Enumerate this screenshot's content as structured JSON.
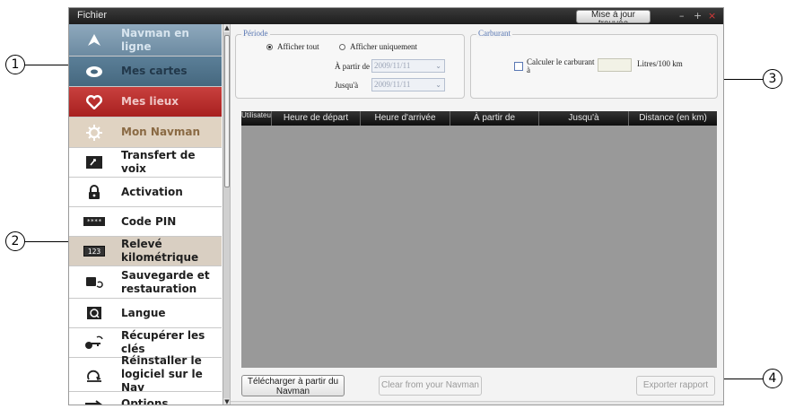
{
  "app": {
    "menu": "Fichier",
    "update_button": "Mise à jour trouvée",
    "controls": {
      "minimize": "–",
      "maximize": "+",
      "close": "×"
    }
  },
  "sidebar": {
    "items": [
      {
        "label": "Navman en ligne",
        "icon": "compass-icon"
      },
      {
        "label": "Mes cartes",
        "icon": "map-icon"
      },
      {
        "label": "Mes lieux",
        "icon": "heart-icon"
      },
      {
        "label": "Mon Navman",
        "icon": "gear-icon"
      },
      {
        "label": "Transfert de voix",
        "icon": "voice-transfer-icon"
      },
      {
        "label": "Activation",
        "icon": "lock-icon"
      },
      {
        "label": "Code PIN",
        "icon": "pin-code-icon"
      },
      {
        "label": "Relevé kilométrique",
        "icon": "odometer-icon"
      },
      {
        "label": "Sauvegarde et restauration",
        "icon": "backup-icon"
      },
      {
        "label": "Langue",
        "icon": "language-icon"
      },
      {
        "label": "Récupérer les clés",
        "icon": "key-icon"
      },
      {
        "label": "Réinstaller le logiciel sur le Nav",
        "icon": "reinstall-icon"
      },
      {
        "label": "Options",
        "icon": "options-icon"
      }
    ],
    "pin_icon_text": "****",
    "odometer_icon_text": "123"
  },
  "periode": {
    "legend": "Période",
    "show_all": "Afficher tout",
    "show_only": "Afficher uniquement",
    "from_label": "À partir de",
    "to_label": "Jusqu'à",
    "from_value": "2009/11/11",
    "to_value": "2009/11/11"
  },
  "carburant": {
    "legend": "Carburant",
    "calc_label": "Calculer le carburant à",
    "unit": "Litres/100 km"
  },
  "table": {
    "columns": [
      "Utilisateur",
      "Heure de départ",
      "Heure d'arrivée",
      "À partir de",
      "Jusqu'à",
      "Distance (en km)"
    ]
  },
  "buttons": {
    "download": "Télécharger à partir du Navman",
    "clear": "Clear from your Navman",
    "export": "Exporter rapport"
  },
  "callouts": [
    "1",
    "2",
    "3",
    "4"
  ]
}
